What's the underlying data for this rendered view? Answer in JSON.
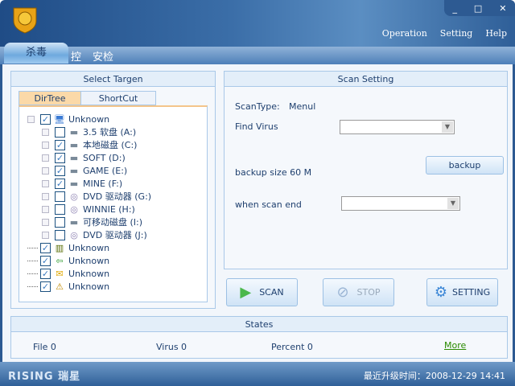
{
  "header": {
    "menu": [
      "Operation",
      "Setting",
      "Help"
    ],
    "window_buttons": {
      "minimize": "_",
      "maximize": "□",
      "close": "✕"
    }
  },
  "tabs": [
    {
      "label": "杀毒",
      "active": true
    },
    {
      "label": "控"
    },
    {
      "label": "安检"
    }
  ],
  "select_target": {
    "title": "Select Targen",
    "tabs": [
      "DirTree",
      "ShortCut"
    ],
    "tree": [
      {
        "label": "Unknown",
        "icon": "computer-icon",
        "checked": true,
        "level": 0
      },
      {
        "label": "3.5 软盘 (A:)",
        "icon": "drive-icon",
        "checked": false,
        "level": 1
      },
      {
        "label": "本地磁盘 (C:)",
        "icon": "drive-icon",
        "checked": true,
        "level": 1
      },
      {
        "label": "SOFT (D:)",
        "icon": "drive-icon",
        "checked": true,
        "level": 1
      },
      {
        "label": "GAME (E:)",
        "icon": "drive-icon",
        "checked": true,
        "level": 1
      },
      {
        "label": "MINE (F:)",
        "icon": "drive-icon",
        "checked": true,
        "level": 1
      },
      {
        "label": "DVD 驱动器 (G:)",
        "icon": "dvd-icon",
        "checked": false,
        "level": 1
      },
      {
        "label": "WINNIE (H:)",
        "icon": "dvd-icon",
        "checked": false,
        "level": 1
      },
      {
        "label": "可移动磁盘 (I:)",
        "icon": "drive-icon",
        "checked": false,
        "level": 1
      },
      {
        "label": "DVD 驱动器 (J:)",
        "icon": "dvd-icon",
        "checked": false,
        "level": 1
      },
      {
        "label": "Unknown",
        "icon": "memory-icon",
        "checked": true,
        "level": 0
      },
      {
        "label": "Unknown",
        "icon": "boot-icon",
        "checked": true,
        "level": 0
      },
      {
        "label": "Unknown",
        "icon": "mail-icon",
        "checked": true,
        "level": 0
      },
      {
        "label": "Unknown",
        "icon": "warning-drive-icon",
        "checked": true,
        "level": 0
      }
    ]
  },
  "scan_setting": {
    "title": "Scan Setting",
    "scan_type_label": "ScanType:",
    "scan_type_value": "Menul",
    "find_virus_label": "Find Virus",
    "backup_size": "backup size 60 M",
    "backup_button": "backup",
    "when_scan_end_label": "when scan end"
  },
  "actions": {
    "scan": "SCAN",
    "stop": "STOP",
    "setting": "SETTING"
  },
  "states": {
    "title": "States",
    "file": "File 0",
    "virus": "Virus 0",
    "percent": "Percent 0",
    "more": "More"
  },
  "footer": {
    "brand": "RISING 瑞星",
    "update_time": "最近升级时间：2008-12-29 14:41"
  },
  "colors": {
    "accent": "#2d5a92",
    "link": "#2a8a00"
  }
}
